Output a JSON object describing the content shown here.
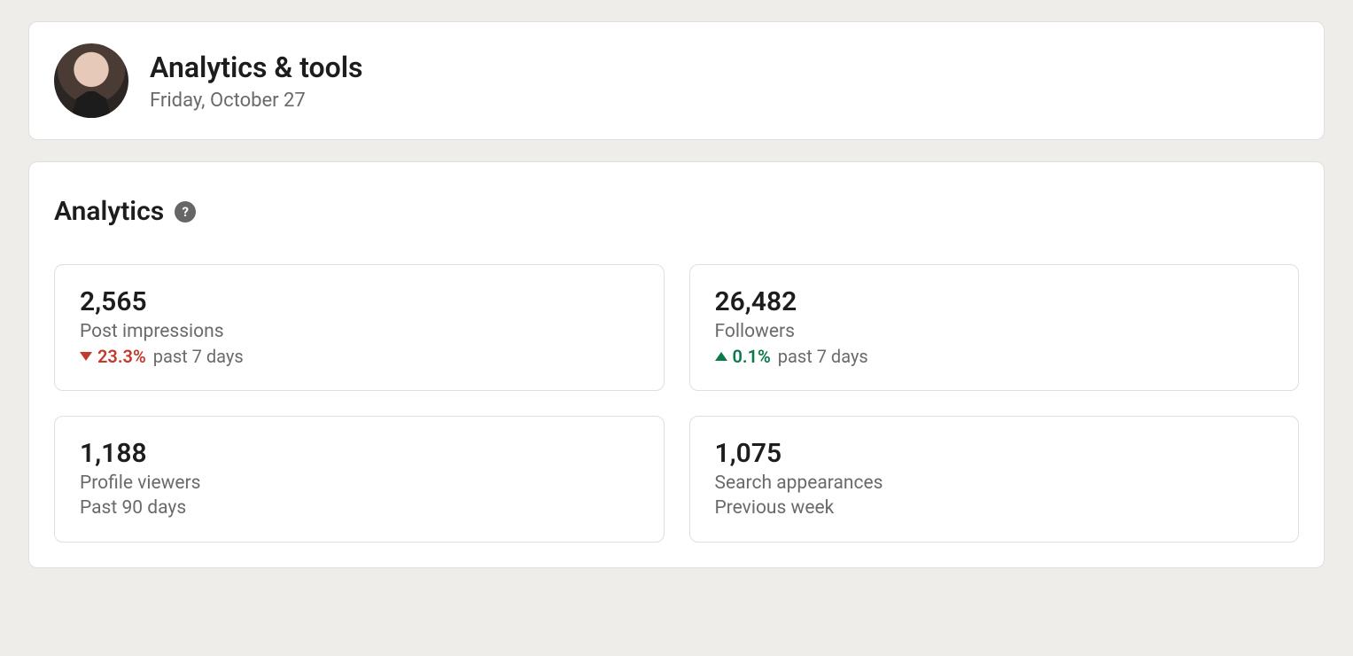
{
  "header": {
    "title": "Analytics & tools",
    "date": "Friday, October 27"
  },
  "analytics": {
    "section_title": "Analytics",
    "help_glyph": "?",
    "stats": [
      {
        "value": "2,565",
        "label": "Post impressions",
        "trend_direction": "down",
        "trend_pct": "23.3%",
        "trend_period": "past 7 days"
      },
      {
        "value": "26,482",
        "label": "Followers",
        "trend_direction": "up",
        "trend_pct": "0.1%",
        "trend_period": "past 7 days"
      },
      {
        "value": "1,188",
        "label": "Profile viewers",
        "period": "Past 90 days"
      },
      {
        "value": "1,075",
        "label": "Search appearances",
        "period": "Previous week"
      }
    ]
  }
}
